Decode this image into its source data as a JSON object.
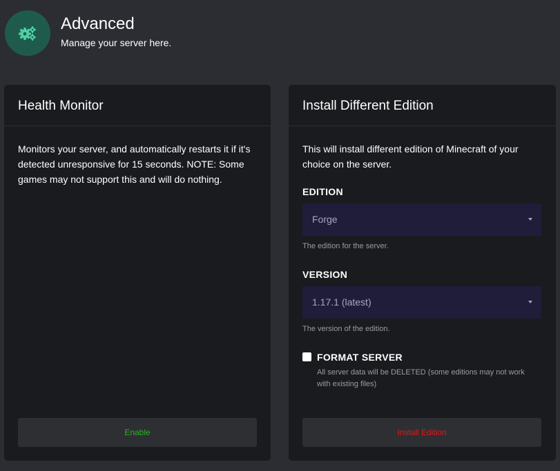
{
  "header": {
    "icon": "gears-icon",
    "title": "Advanced",
    "subtitle": "Manage your server here."
  },
  "health_monitor": {
    "title": "Health Monitor",
    "description": "Monitors your server, and automatically restarts it if it's detected unresponsive for 15 seconds. NOTE: Some games may not support this and will do nothing.",
    "button_label": "Enable"
  },
  "install_edition": {
    "title": "Install Different Edition",
    "description": "This will install different edition of Minecraft of your choice on the server.",
    "edition": {
      "label": "EDITION",
      "value": "Forge",
      "help": "The edition for the server."
    },
    "version": {
      "label": "VERSION",
      "value": "1.17.1 (latest)",
      "help": "The version of the edition."
    },
    "format_server": {
      "label": "FORMAT SERVER",
      "checked": false,
      "description": "All server data will be DELETED (some editions may not work with existing files)"
    },
    "button_label": "Install Edition"
  },
  "colors": {
    "background": "#2b2d32",
    "card": "#1a1b1e",
    "icon_circle": "#1f5b4c",
    "icon": "#4fd1a5",
    "select_bg": "#1f1d3a",
    "enable": "#27b523",
    "danger": "#e21818"
  }
}
